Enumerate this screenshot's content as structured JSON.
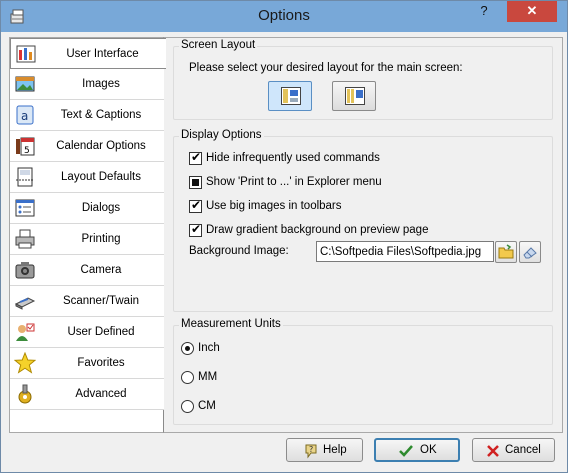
{
  "window": {
    "title": "Options",
    "help_label": "?",
    "close_label": "✕"
  },
  "sidebar": {
    "items": [
      {
        "label": "User Interface",
        "icon": "user-interface-icon",
        "active": true
      },
      {
        "label": "Images",
        "icon": "images-icon"
      },
      {
        "label": "Text & Captions",
        "icon": "text-captions-icon"
      },
      {
        "label": "Calendar Options",
        "icon": "calendar-icon"
      },
      {
        "label": "Layout Defaults",
        "icon": "layout-defaults-icon"
      },
      {
        "label": "Dialogs",
        "icon": "dialogs-icon"
      },
      {
        "label": "Printing",
        "icon": "printer-icon"
      },
      {
        "label": "Camera",
        "icon": "camera-icon"
      },
      {
        "label": "Scanner/Twain",
        "icon": "scanner-icon"
      },
      {
        "label": "User Defined",
        "icon": "user-defined-icon"
      },
      {
        "label": "Favorites",
        "icon": "star-icon"
      },
      {
        "label": "Advanced",
        "icon": "advanced-icon"
      }
    ]
  },
  "screen_layout": {
    "title": "Screen Layout",
    "prompt": "Please select your desired layout for the main screen:",
    "selected_index": 0
  },
  "display_options": {
    "title": "Display Options",
    "options": [
      {
        "label": "Hide infrequently used commands",
        "state": "checked"
      },
      {
        "label": "Show 'Print to ...' in Explorer menu",
        "state": "indeterminate"
      },
      {
        "label": "Use big images in toolbars",
        "state": "checked"
      },
      {
        "label": "Draw gradient background on preview page",
        "state": "checked"
      }
    ],
    "background_label": "Background Image:",
    "background_value": "C:\\Softpedia Files\\Softpedia.jpg"
  },
  "measurement": {
    "title": "Measurement Units",
    "units": [
      "Inch",
      "MM",
      "CM"
    ],
    "selected": "Inch"
  },
  "buttons": {
    "help": "Help",
    "ok": "OK",
    "cancel": "Cancel"
  },
  "colors": {
    "titlebar": "#78a8d8",
    "close": "#c9483e",
    "default_border": "#3c7fb1"
  }
}
